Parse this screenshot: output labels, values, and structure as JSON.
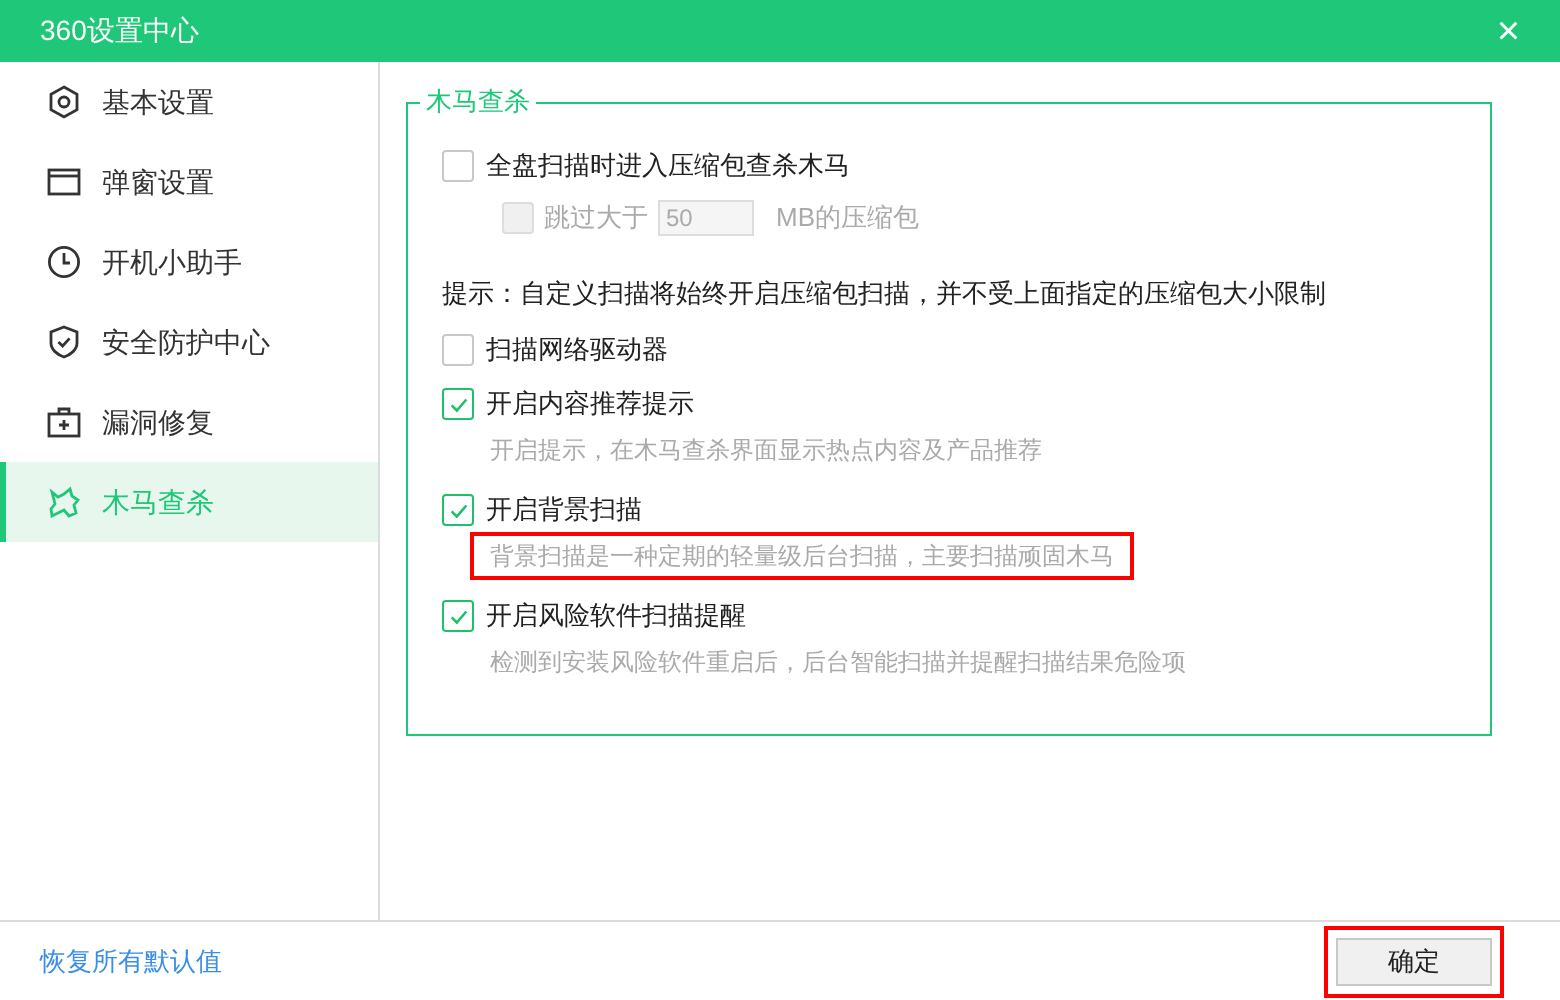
{
  "window": {
    "title": "360设置中心",
    "close": "×"
  },
  "sidebar": {
    "items": [
      {
        "label": "基本设置",
        "selected": false
      },
      {
        "label": "弹窗设置",
        "selected": false
      },
      {
        "label": "开机小助手",
        "selected": false
      },
      {
        "label": "安全防护中心",
        "selected": false
      },
      {
        "label": "漏洞修复",
        "selected": false
      },
      {
        "label": "木马查杀",
        "selected": true
      }
    ]
  },
  "group": {
    "title": "木马查杀",
    "options": [
      {
        "kind": "checkbox",
        "label": "全盘扫描时进入压缩包查杀木马",
        "checked": false
      },
      {
        "kind": "size_limit",
        "label": "跳过大于",
        "value": "50",
        "unit": "MB的压缩包",
        "checked": false,
        "disabled": true
      },
      {
        "kind": "note",
        "text": "提示：自定义扫描将始终开启压缩包扫描，并不受上面指定的压缩包大小限制"
      },
      {
        "kind": "checkbox",
        "label": "扫描网络驱动器",
        "checked": false
      },
      {
        "kind": "checkbox",
        "label": "开启内容推荐提示",
        "checked": true,
        "description": "开启提示，在木马查杀界面显示热点内容及产品推荐",
        "highlighted": false
      },
      {
        "kind": "checkbox",
        "label": "开启背景扫描",
        "checked": true,
        "description": "背景扫描是一种定期的轻量级后台扫描，主要扫描顽固木马",
        "highlighted": true
      },
      {
        "kind": "checkbox",
        "label": "开启风险软件扫描提醒",
        "checked": true,
        "description": "检测到安装风险软件重启后，后台智能扫描并提醒扫描结果危险项",
        "highlighted": false
      }
    ]
  },
  "footer": {
    "restore_link": "恢复所有默认值",
    "ok_button": {
      "label": "确定",
      "highlighted": true
    }
  }
}
